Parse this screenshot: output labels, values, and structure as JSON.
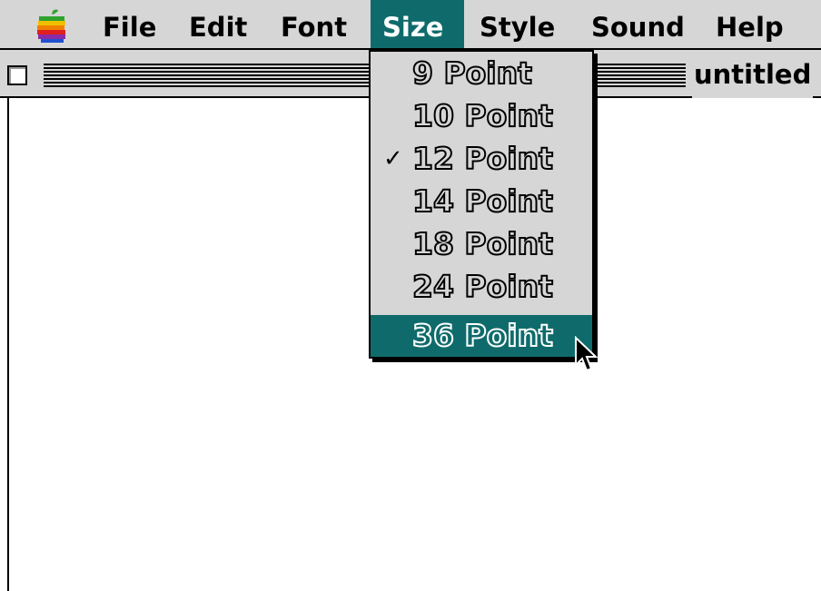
{
  "menubar": {
    "apple_icon": "rainbow-apple-icon",
    "menus": [
      "File",
      "Edit",
      "Font",
      "Size",
      "Style",
      "Sound",
      "Help"
    ],
    "active_menu": "Size"
  },
  "window": {
    "title": "untitled",
    "close_box_icon": "close-box-icon"
  },
  "size_menu": {
    "items": [
      "9 Point",
      "10 Point",
      "12 Point",
      "14 Point",
      "18 Point",
      "24 Point",
      "36 Point"
    ],
    "checked_item": "12 Point",
    "highlighted_item": "36 Point",
    "check_glyph": "✓"
  },
  "cursor": "arrow-cursor-icon",
  "colors": {
    "highlight": "#0f6b6b",
    "menu_bg": "#d6d6d6"
  }
}
